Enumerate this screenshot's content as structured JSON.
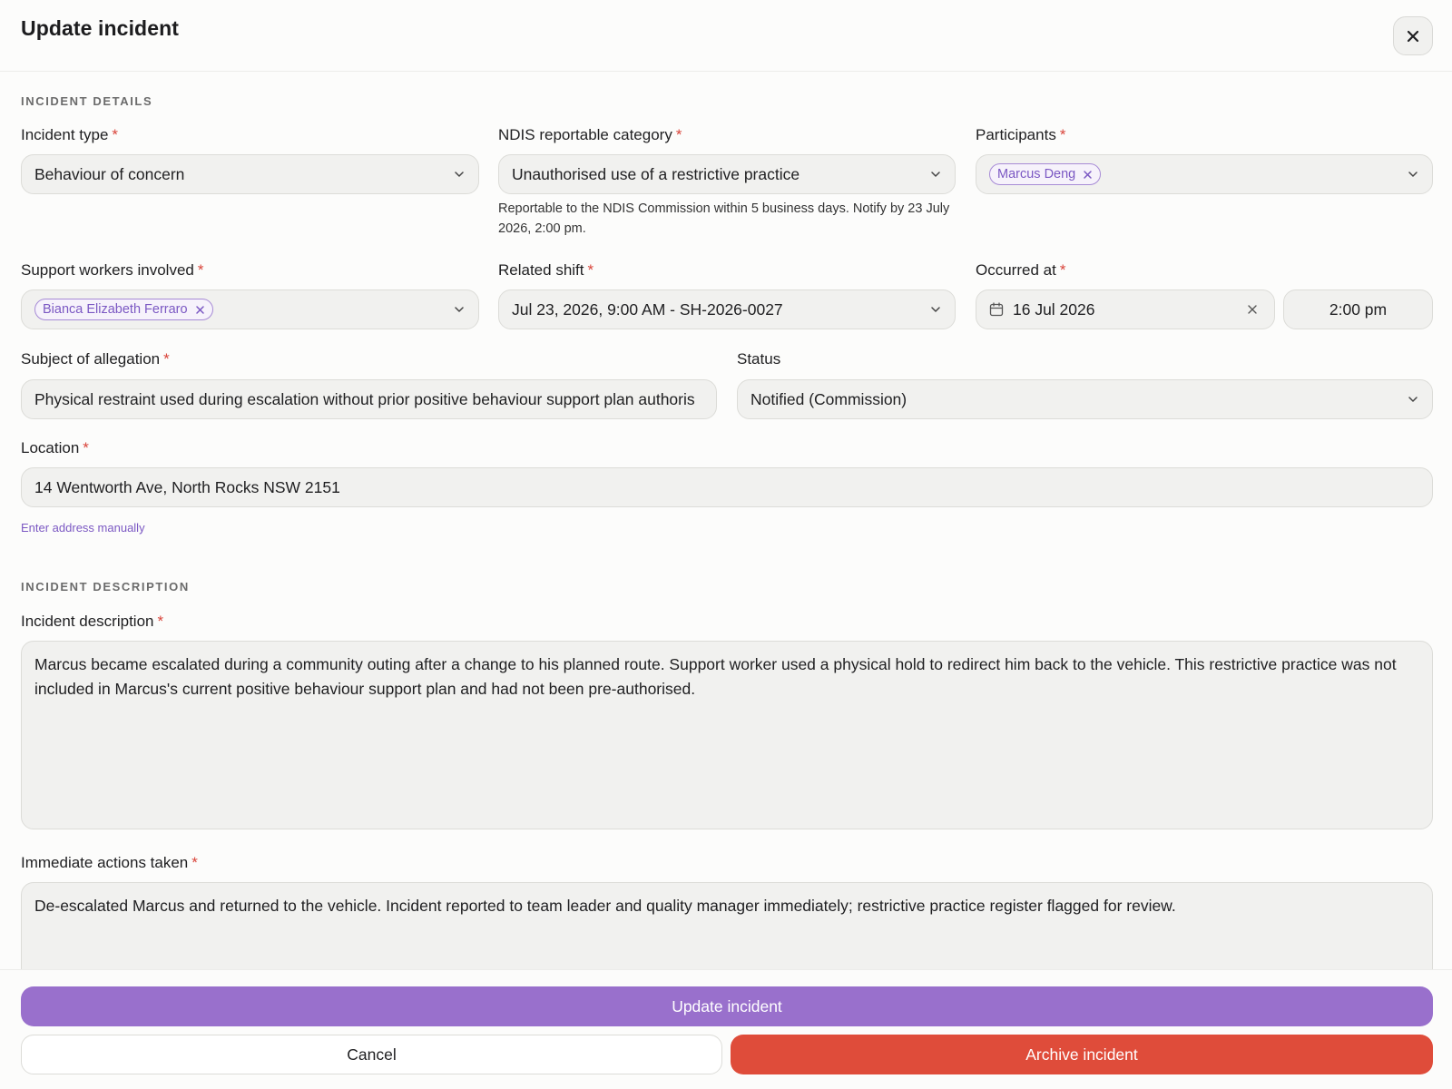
{
  "dialog": {
    "title": "Update incident"
  },
  "sections": {
    "details": "INCIDENT DETAILS",
    "description": "INCIDENT DESCRIPTION"
  },
  "incident_type": {
    "label": "Incident type",
    "value": "Behaviour of concern"
  },
  "ndis_category": {
    "label": "NDIS reportable category",
    "value": "Unauthorised use of a restrictive practice",
    "helper": "Reportable to the NDIS Commission within 5 business days. Notify by 23 July 2026, 2:00 pm."
  },
  "participants": {
    "label": "Participants",
    "chips": [
      "Marcus Deng"
    ]
  },
  "support_workers": {
    "label": "Support workers involved",
    "chips": [
      "Bianca Elizabeth Ferraro"
    ]
  },
  "related_shift": {
    "label": "Related shift",
    "value": "Jul 23, 2026, 9:00 AM - SH-2026-0027"
  },
  "occurred_at": {
    "label": "Occurred at",
    "date": "16 Jul 2026",
    "time": "2:00 pm"
  },
  "subject": {
    "label": "Subject of allegation",
    "value": "Physical restraint used during escalation without prior positive behaviour support plan authoris"
  },
  "status": {
    "label": "Status",
    "value": "Notified (Commission)"
  },
  "location": {
    "label": "Location",
    "value": "14 Wentworth Ave, North Rocks NSW 2151",
    "manual_link": "Enter address manually"
  },
  "incident_description": {
    "label": "Incident description",
    "value": "Marcus became escalated during a community outing after a change to his planned route. Support worker used a physical hold to redirect him back to the vehicle. This restrictive practice was not included in Marcus's current positive behaviour support plan and had not been pre-authorised."
  },
  "immediate_actions": {
    "label": "Immediate actions taken",
    "value": "De-escalated Marcus and returned to the vehicle. Incident reported to team leader and quality manager immediately; restrictive practice register flagged for review."
  },
  "footer": {
    "update_label": "Update incident",
    "cancel_label": "Cancel",
    "archive_label": "Archive incident"
  },
  "colors": {
    "accent": "#9970cc",
    "danger": "#df4c3a",
    "required": "#d9443a"
  }
}
